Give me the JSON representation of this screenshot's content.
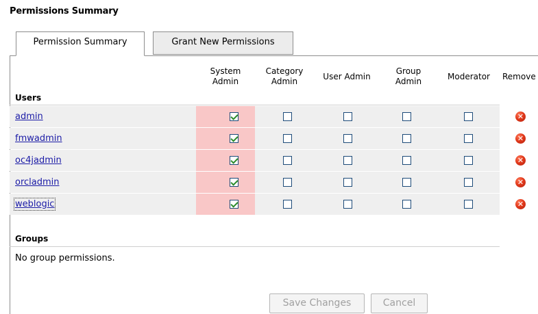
{
  "page": {
    "title": "Permissions Summary"
  },
  "tabs": [
    {
      "label": "Permission Summary",
      "active": true
    },
    {
      "label": "Grant New Permissions",
      "active": false
    }
  ],
  "columns": [
    {
      "line1": "System",
      "line2": "Admin"
    },
    {
      "line1": "Category",
      "line2": "Admin"
    },
    {
      "line1": "User Admin",
      "line2": ""
    },
    {
      "line1": "Group",
      "line2": "Admin"
    },
    {
      "line1": "Moderator",
      "line2": ""
    },
    {
      "line1": "Remove",
      "line2": ""
    }
  ],
  "users_section": {
    "label": "Users",
    "rows": [
      {
        "name": "admin",
        "system_admin": true,
        "category_admin": false,
        "user_admin": false,
        "group_admin": false,
        "moderator": false
      },
      {
        "name": "fmwadmin",
        "system_admin": true,
        "category_admin": false,
        "user_admin": false,
        "group_admin": false,
        "moderator": false
      },
      {
        "name": "oc4jadmin",
        "system_admin": true,
        "category_admin": false,
        "user_admin": false,
        "group_admin": false,
        "moderator": false
      },
      {
        "name": "orcladmin",
        "system_admin": true,
        "category_admin": false,
        "user_admin": false,
        "group_admin": false,
        "moderator": false
      },
      {
        "name": "weblogic",
        "system_admin": true,
        "category_admin": false,
        "user_admin": false,
        "group_admin": false,
        "moderator": false
      }
    ]
  },
  "groups_section": {
    "label": "Groups",
    "empty_message": "No group permissions."
  },
  "buttons": {
    "save_label": "Save Changes",
    "cancel_label": "Cancel"
  },
  "colors": {
    "system_admin_highlight": "#f9c7c7",
    "row_shade": "#efefef",
    "link": "#1a1aa6"
  },
  "icons": {
    "remove": "remove-x-icon",
    "checkbox_checked": "check-icon"
  }
}
